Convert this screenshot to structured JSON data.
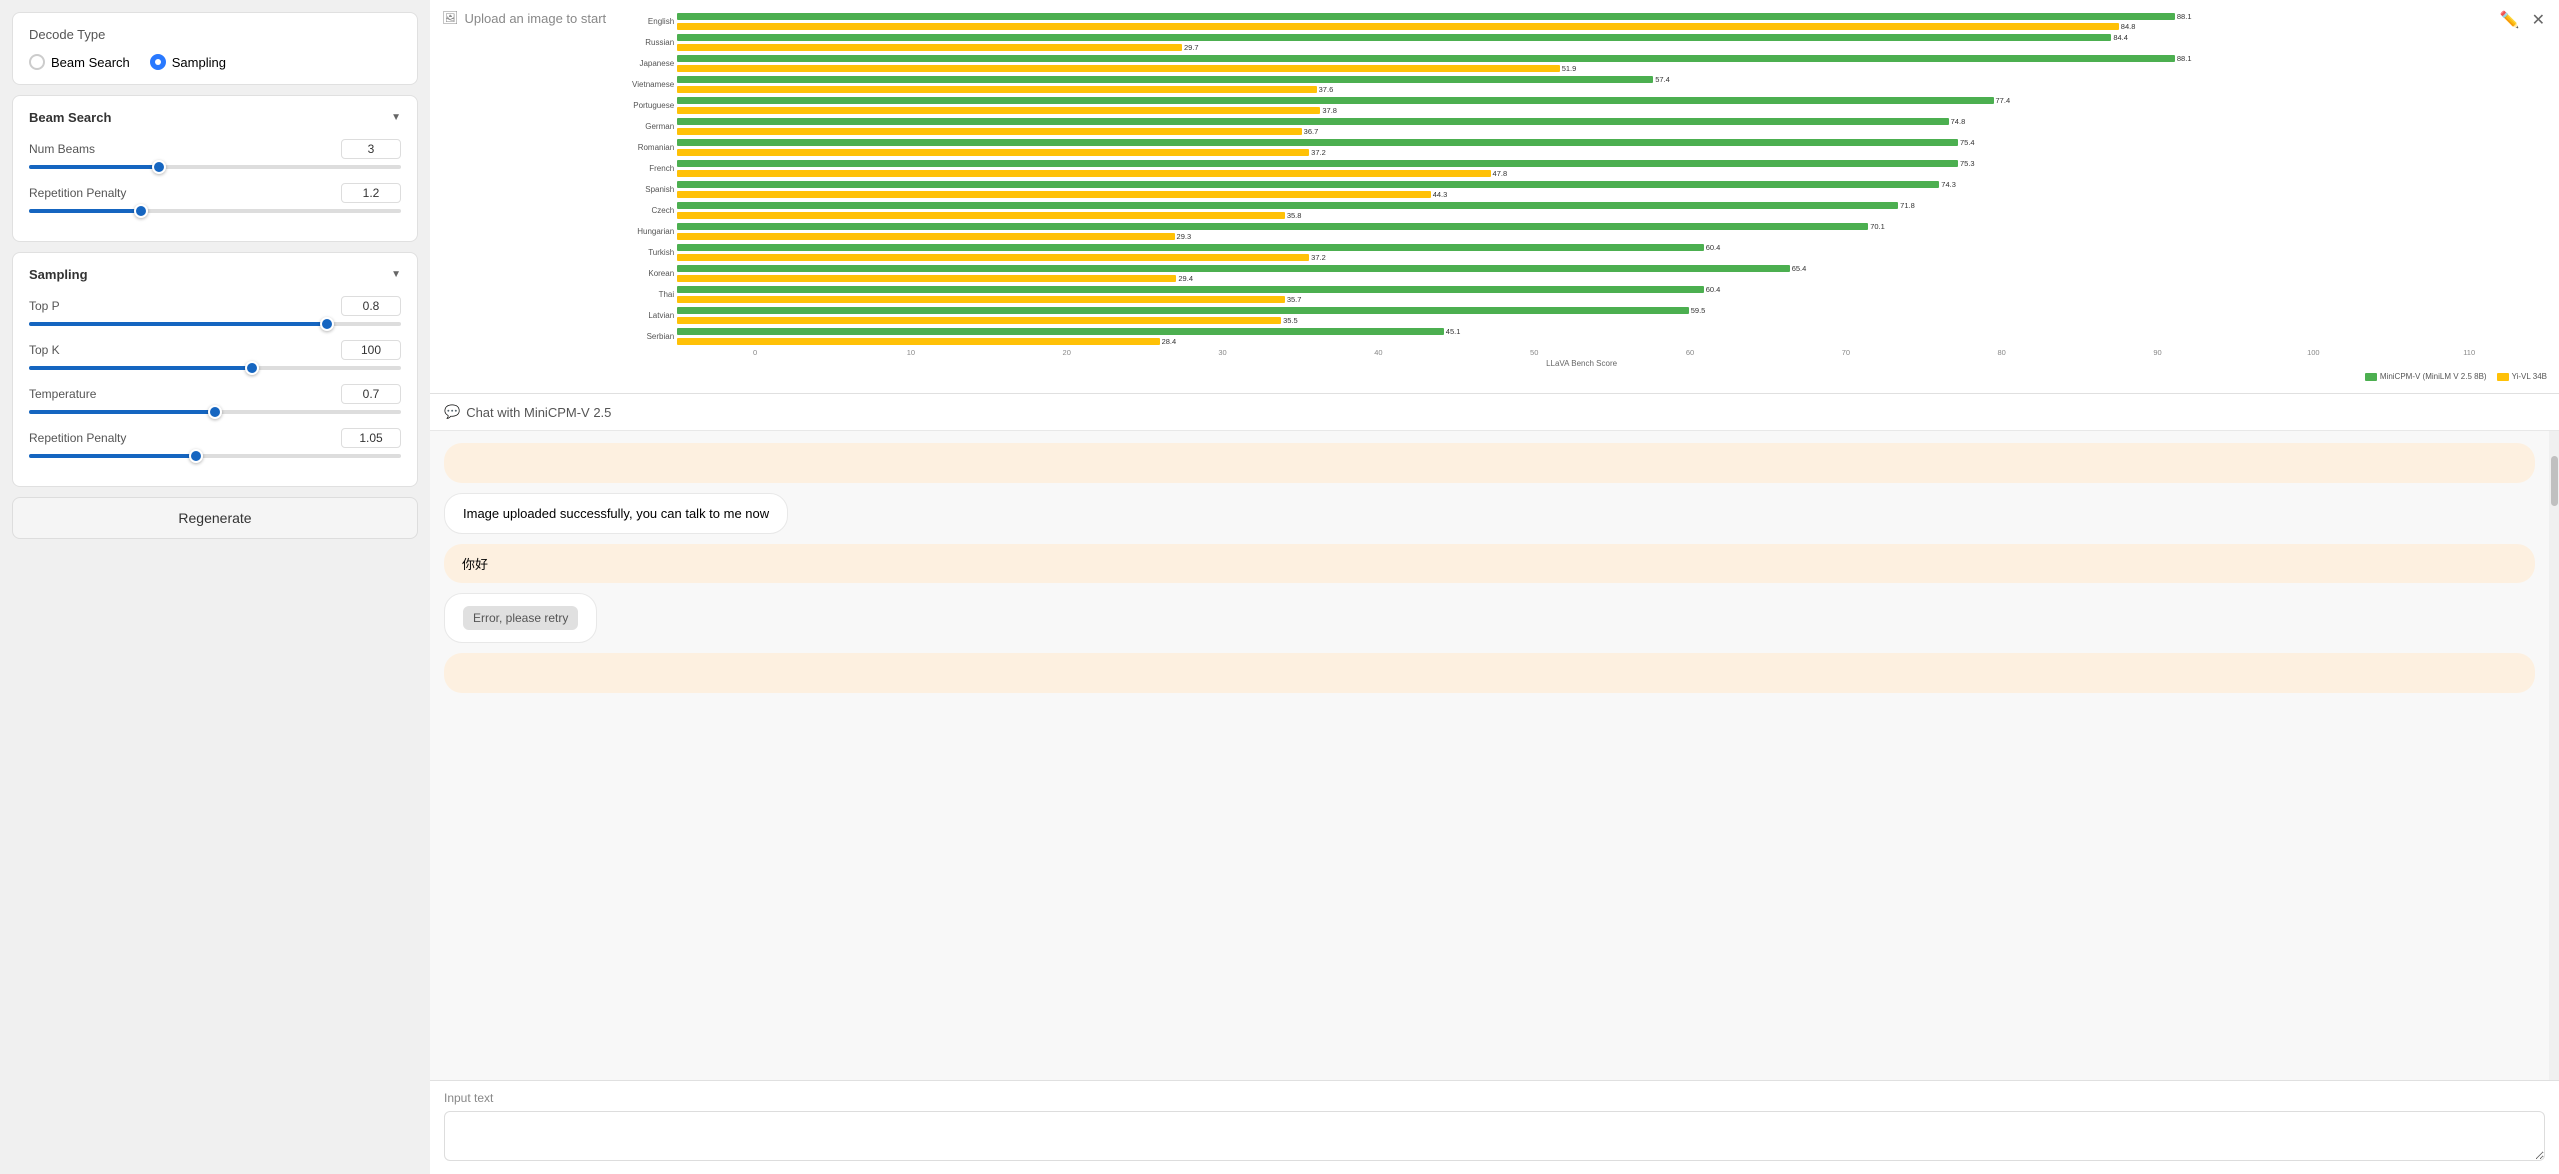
{
  "left_panel": {
    "decode_type_title": "Decode Type",
    "options": [
      {
        "label": "Beam Search",
        "selected": false
      },
      {
        "label": "Sampling",
        "selected": true
      }
    ],
    "beam_search": {
      "title": "Beam Search",
      "params": [
        {
          "label": "Num Beams",
          "value": "3",
          "fill_pct": 35,
          "thumb_pct": 35
        },
        {
          "label": "Repetition Penalty",
          "value": "1.2",
          "fill_pct": 30,
          "thumb_pct": 30
        }
      ]
    },
    "sampling": {
      "title": "Sampling",
      "params": [
        {
          "label": "Top P",
          "value": "0.8",
          "fill_pct": 80,
          "thumb_pct": 80
        },
        {
          "label": "Top K",
          "value": "100",
          "fill_pct": 60,
          "thumb_pct": 60
        },
        {
          "label": "Temperature",
          "value": "0.7",
          "fill_pct": 50,
          "thumb_pct": 50
        },
        {
          "label": "Repetition Penalty",
          "value": "1.05",
          "fill_pct": 45,
          "thumb_pct": 45
        }
      ]
    },
    "regenerate_label": "Regenerate"
  },
  "right_panel": {
    "upload_label": "Upload an image to start",
    "chat_header": "Chat with MiniCPM-V 2.5",
    "messages": [
      {
        "type": "user",
        "text": ""
      },
      {
        "type": "bot",
        "text": "Image uploaded successfully, you can talk to me now"
      },
      {
        "type": "user",
        "text": "你好"
      },
      {
        "type": "error",
        "text": "Error, please retry"
      },
      {
        "type": "user",
        "text": ""
      }
    ],
    "input_label": "Input text",
    "input_placeholder": ""
  },
  "chart": {
    "title": "LLaVA Bench Score",
    "legend": [
      {
        "label": "MiniCPM-V (MiniLM V 2.5 8B)",
        "color": "#4caf50"
      },
      {
        "label": "Yi-VL 34B",
        "color": "#ffc107"
      }
    ],
    "bars": [
      {
        "lang": "English",
        "v1": 88.1,
        "v2": 84.8
      },
      {
        "lang": "Russian",
        "v1": 84.4,
        "v2": 29.7
      },
      {
        "lang": "Japanese",
        "v1": 88.1,
        "v2": 51.9
      },
      {
        "lang": "Vietnamese",
        "v1": 57.4,
        "v2": 37.6
      },
      {
        "lang": "Portuguese",
        "v1": 77.4,
        "v2": 37.8
      },
      {
        "lang": "German",
        "v1": 74.8,
        "v2": 36.7
      },
      {
        "lang": "Romanian",
        "v1": 75.4,
        "v2": 37.2
      },
      {
        "lang": "French",
        "v1": 75.3,
        "v2": 47.8
      },
      {
        "lang": "Spanish",
        "v1": 74.3,
        "v2": 44.3
      },
      {
        "lang": "Czech",
        "v1": 71.8,
        "v2": 35.8
      },
      {
        "lang": "Hungarian",
        "v1": 70.1,
        "v2": 29.3
      },
      {
        "lang": "Turkish",
        "v1": 60.4,
        "v2": 37.2
      },
      {
        "lang": "Korean",
        "v1": 65.4,
        "v2": 29.4
      },
      {
        "lang": "Thai",
        "v1": 60.4,
        "v2": 35.7
      },
      {
        "lang": "Latvian",
        "v1": 59.5,
        "v2": 35.5
      },
      {
        "lang": "Serbian",
        "v1": 45.1,
        "v2": 28.4
      }
    ],
    "x_ticks": [
      "0",
      "10",
      "20",
      "30",
      "40",
      "50",
      "60",
      "70",
      "80",
      "90",
      "100",
      "110"
    ]
  },
  "icons": {
    "upload": "🖼",
    "chat": "💬",
    "edit": "✏️",
    "close": "✕",
    "collapse_down": "▼"
  }
}
